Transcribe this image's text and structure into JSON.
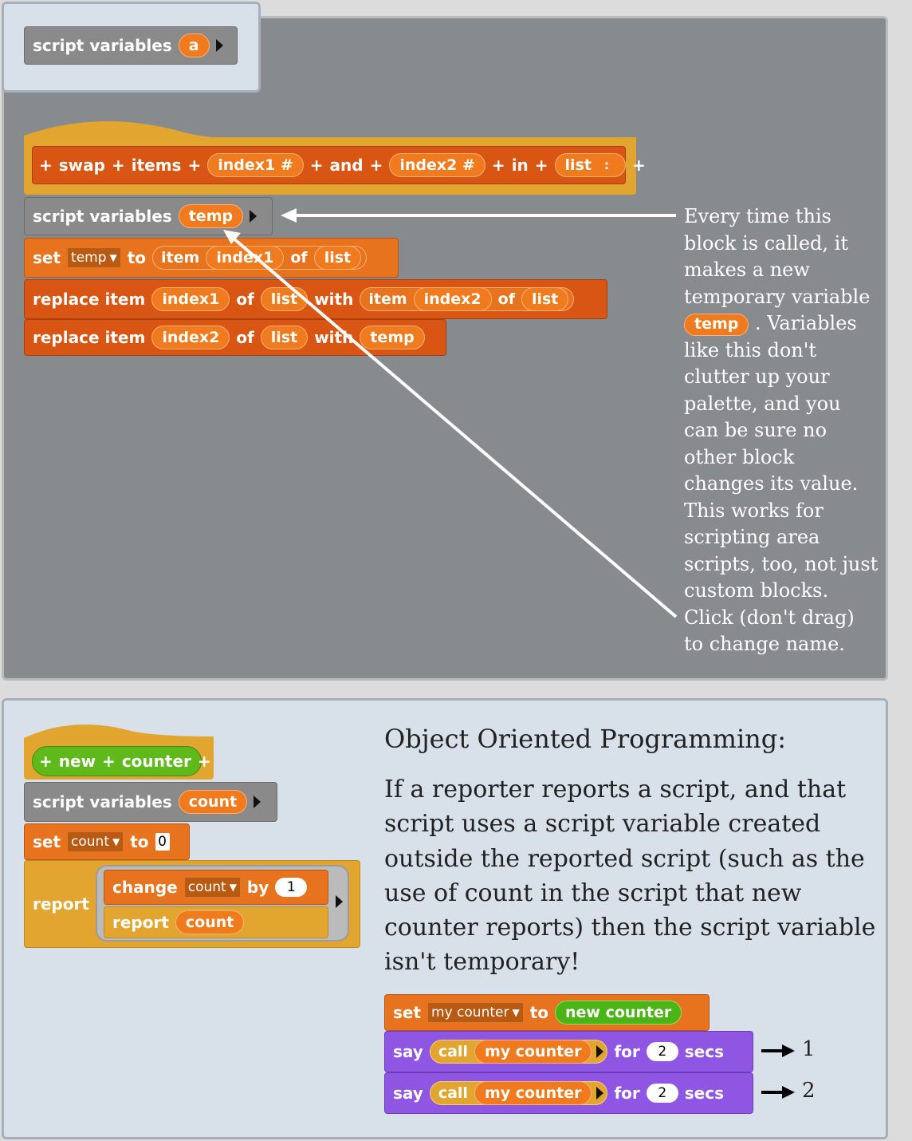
{
  "top_tab": {
    "label": "script variables",
    "var": "a"
  },
  "swap_block": {
    "plus": "+",
    "word_swap": "swap",
    "word_items": "items",
    "param1": "index1 #",
    "word_and": "and",
    "param2": "index2 #",
    "word_in": "in",
    "param3": "list",
    "param3_type": ":"
  },
  "script_vars_temp": {
    "label": "script variables",
    "var": "temp"
  },
  "set_temp": {
    "set": "set",
    "var": "temp",
    "to": "to",
    "item": "item",
    "index": "index1",
    "of": "of",
    "list": "list"
  },
  "replace1": {
    "label": "replace item",
    "index": "index1",
    "of": "of",
    "list": "list",
    "with": "with",
    "item": "item",
    "index2": "index2",
    "of2": "of",
    "list2": "list"
  },
  "replace2": {
    "label": "replace item",
    "index": "index2",
    "of": "of",
    "list": "list",
    "with": "with",
    "temp": "temp"
  },
  "annotation": {
    "lines_before": [
      "Every time this",
      "block is called, it",
      "makes a new",
      "temporary variable"
    ],
    "temp_chip": "temp",
    "after_chip": ". Variables",
    "lines_after": [
      "like this don't",
      "clutter up your",
      "palette, and you",
      "can be sure no",
      "other block",
      "changes its value.",
      "This works for",
      "scripting area",
      "scripts, too, not just",
      "custom blocks.",
      "Click (don't drag)",
      "to change name."
    ]
  },
  "counter_block": {
    "plus": "+",
    "word_new": "new",
    "word_counter": "counter",
    "script_vars_label": "script variables",
    "script_var": "count",
    "set": "set",
    "set_var": "count",
    "to": "to",
    "set_value": "0",
    "report": "report",
    "change": "change",
    "change_var": "count",
    "by": "by",
    "by_value": "1",
    "inner_report": "report",
    "inner_count": "count"
  },
  "oop": {
    "heading": "Object Oriented Programming:",
    "paragraph": [
      "If a reporter reports a script, and that",
      "script uses a script variable created",
      "outside the reported script (such as the",
      "use of count in the script that new",
      "counter reports) then the script variable",
      "isn't temporary!"
    ]
  },
  "example": {
    "set": "set",
    "var": "my counter",
    "to": "to",
    "value": "new counter",
    "say": "say",
    "call": "call",
    "callee": "my counter",
    "for": "for",
    "secs_value": "2",
    "secs": "secs",
    "result1": "1",
    "result2": "2"
  },
  "colors": {
    "panel_gray": "#878b8d",
    "panel_light": "#d8e0ea",
    "block_orange": "#e8731e",
    "block_custom": "#d95514",
    "block_purple": "#8f56e3",
    "block_gray": "#8a8a8a",
    "hat_gold": "#e2a630",
    "green": "#5fb91b"
  }
}
